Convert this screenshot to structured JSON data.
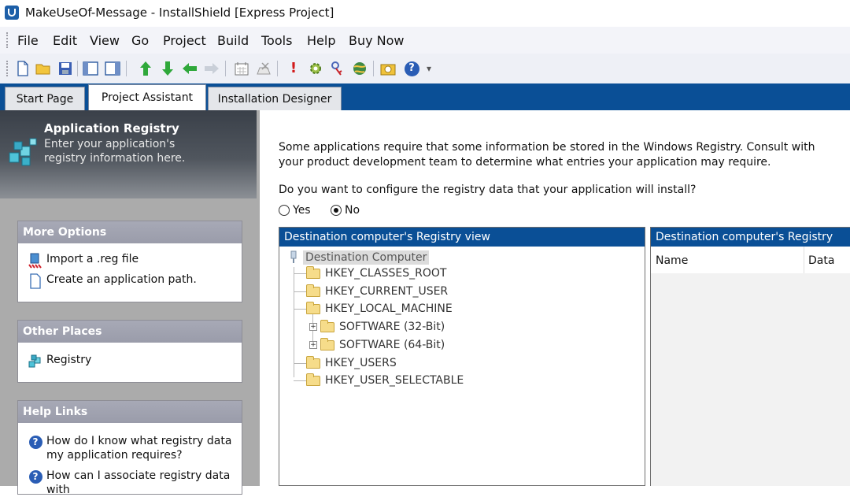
{
  "window": {
    "title": "MakeUseOf-Message - InstallShield [Express Project]"
  },
  "menubar": {
    "items": [
      "File",
      "Edit",
      "View",
      "Go",
      "Project",
      "Build",
      "Tools",
      "Help",
      "Buy Now"
    ]
  },
  "toolbar": {
    "icons": [
      "new-file-icon",
      "open-folder-icon",
      "save-icon",
      "pane-icon",
      "pane-split-icon",
      "up-arrow-icon",
      "down-arrow-icon",
      "back-arrow-icon",
      "forward-arrow-icon",
      "calendar-icon",
      "delete-icon",
      "exclamation-icon",
      "settings-icon",
      "key-icon",
      "globe-icon",
      "build-icon",
      "help-icon",
      "more-icon"
    ]
  },
  "tabs": [
    "Start Page",
    "Project Assistant",
    "Installation Designer"
  ],
  "left": {
    "header_title": "Application Registry",
    "header_desc": "Enter your application's registry information here.",
    "more_options": {
      "title": "More Options",
      "items": [
        "Import a .reg file",
        "Create an application path."
      ]
    },
    "other_places": {
      "title": "Other Places",
      "items": [
        "Registry"
      ]
    },
    "help_links": {
      "title": "Help Links",
      "items": [
        "How do I know what registry data my application requires?",
        "How can I associate registry data with"
      ]
    }
  },
  "main": {
    "intro": "Some applications require that some information be stored in the Windows Registry. Consult with your product development team to determine what entries your application may require.",
    "question": "Do you want to configure the registry data that your application will install?",
    "radio_yes": "Yes",
    "radio_no": "No",
    "selected": "No",
    "registry_view_title": "Destination computer's Registry view",
    "registry_data_title": "Destination computer's Registry data",
    "tree_root": "Destination Computer",
    "tree": [
      "HKEY_CLASSES_ROOT",
      "HKEY_CURRENT_USER",
      "HKEY_LOCAL_MACHINE",
      "SOFTWARE (32-Bit)",
      "SOFTWARE (64-Bit)",
      "HKEY_USERS",
      "HKEY_USER_SELECTABLE"
    ],
    "data_columns": [
      "Name",
      "Data"
    ]
  },
  "colors": {
    "accent_blue": "#0a4f96",
    "panel_header": "#a7a9b6",
    "left_bg": "#ababab"
  }
}
